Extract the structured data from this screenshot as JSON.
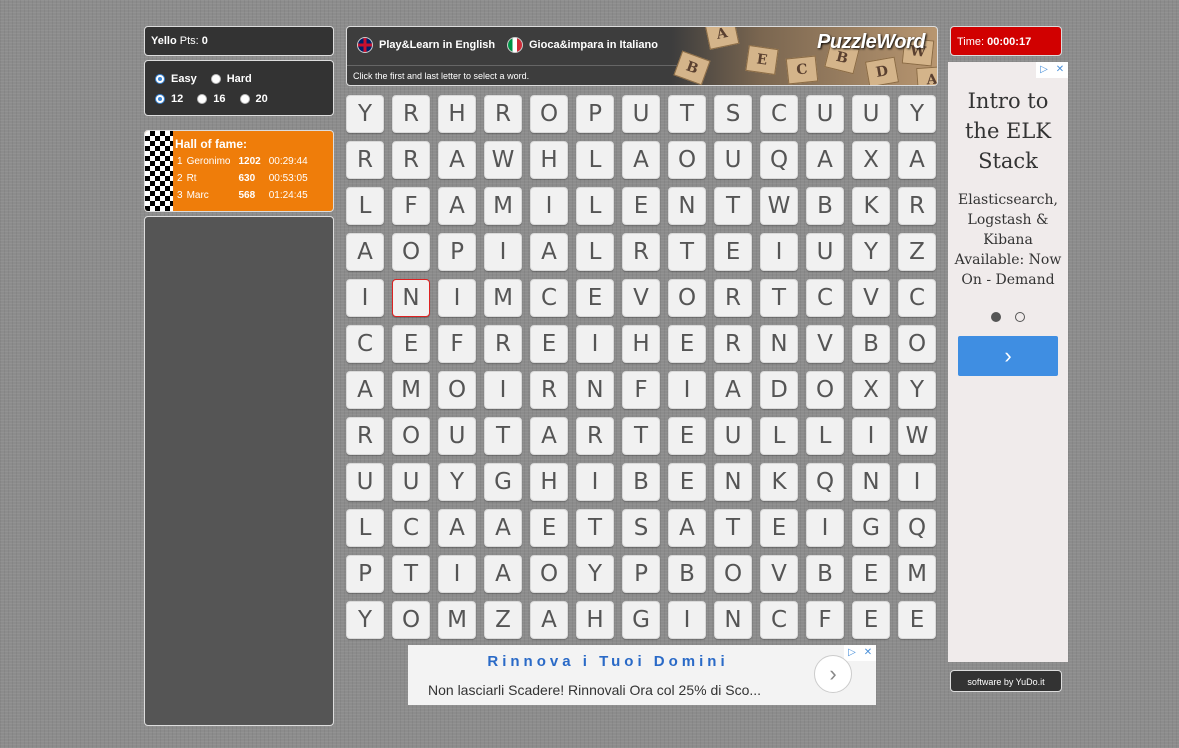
{
  "player": {
    "name": "Yello",
    "pts_label": "Pts:",
    "pts": "0"
  },
  "options": {
    "difficulty": [
      {
        "label": "Easy",
        "selected": true
      },
      {
        "label": "Hard",
        "selected": false
      }
    ],
    "sizes": [
      {
        "label": "12",
        "selected": true
      },
      {
        "label": "16",
        "selected": false
      },
      {
        "label": "20",
        "selected": false
      }
    ]
  },
  "hall_of_fame": {
    "title": "Hall of fame:",
    "entries": [
      {
        "rank": "1",
        "name": "Geronimo",
        "score": "1202",
        "time": "00:29:44"
      },
      {
        "rank": "2",
        "name": "Rt",
        "score": "630",
        "time": "00:53:05"
      },
      {
        "rank": "3",
        "name": "Marc",
        "score": "568",
        "time": "01:24:45"
      }
    ]
  },
  "banner": {
    "lang_en": "Play&Learn in English",
    "lang_it": "Gioca&impara in Italiano",
    "hint": "Click the first and last letter to select a word.",
    "brand": "PuzzleWord",
    "tile_letters": [
      "A",
      "E",
      "C",
      "B",
      "D",
      "W",
      "B",
      "A"
    ]
  },
  "grid": [
    "YRHROPUTSCUUY",
    "RRAWHLAOUQAXA",
    "LFAMILENTWBKR",
    "AOPIALRTEIUYZ",
    "INIMCEVORTCVC",
    "CEFREIHERNVBO",
    "AMOIRNFIADOXY",
    "ROUTARTEULLIW",
    "UUYGHIBENKQNI",
    "LCAAETSATEIGQ",
    "PTIAOYPBOVBEM",
    "YOMZAHGINCFEE"
  ],
  "selected_cell": {
    "row": 4,
    "col": 1
  },
  "timer": {
    "label": "Time:",
    "value": "00:00:17"
  },
  "ad_right": {
    "title": "Intro to the ELK Stack",
    "text": "Elasticsearch, Logstash & Kibana Available: Now On - Demand",
    "arrow": "›"
  },
  "credit": "software by YuDo.it",
  "ad_bottom": {
    "title": "Rinnova i Tuoi Domini",
    "text": "Non lasciarli Scadere! Rinnovali Ora col 25% di Sco...",
    "arrow": "›"
  }
}
